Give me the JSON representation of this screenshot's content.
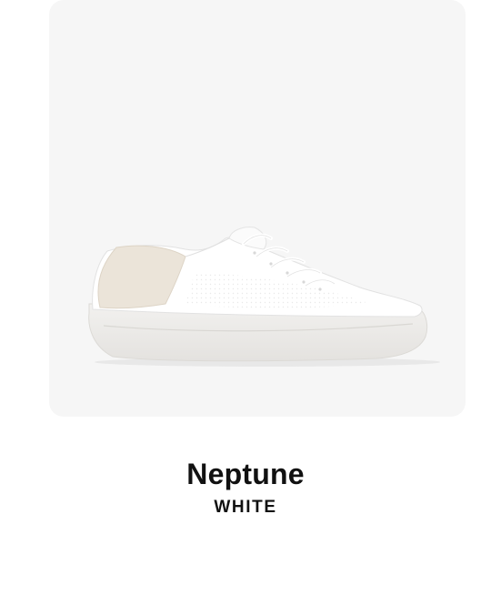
{
  "product": {
    "name": "Neptune",
    "color": "WHITE",
    "image": {
      "icon": "white-knit-sneaker-icon",
      "background_color": "#f6f6f6"
    }
  }
}
